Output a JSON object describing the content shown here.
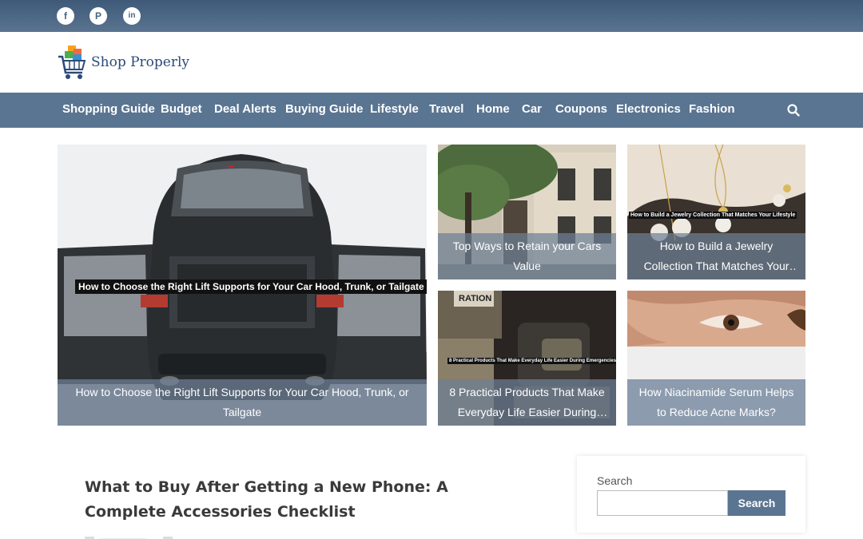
{
  "topbar": {
    "social": [
      {
        "name": "facebook-icon",
        "glyph": "f"
      },
      {
        "name": "pinterest-icon",
        "glyph": "P"
      },
      {
        "name": "linkedin-icon",
        "glyph": "in"
      }
    ]
  },
  "header": {
    "site_name": "Shop Properly"
  },
  "nav": {
    "items": [
      "Shopping Guide",
      "Budget",
      "Deal Alerts",
      "Buying Guide",
      "Lifestyle",
      "Travel",
      "Home",
      "Car",
      "Coupons",
      "Electronics",
      "Fashion"
    ],
    "search_icon": "search-icon"
  },
  "featured": {
    "main": {
      "image_label": "How to Choose the Right Lift Supports for Your Car Hood, Trunk, or Tailgate",
      "caption": "How to Choose the Right Lift Supports for Your Car Hood, Trunk, or Tailgate"
    },
    "tiles": [
      {
        "caption": "Top Ways to Retain your Cars Value"
      },
      {
        "image_label": "How to Build a Jewelry Collection That Matches Your Lifestyle",
        "caption": "How to Build a Jewelry Collection That Matches Your Lifestyle"
      },
      {
        "image_label": "8 Practical Products That Make Everyday Life Easier During Emergencies",
        "caption": "8 Practical Products That Make Everyday Life Easier During Emergencies",
        "sign_text": "RATION"
      },
      {
        "caption": "How Niacinamide Serum Helps to Reduce Acne Marks?"
      }
    ]
  },
  "post": {
    "title": "What to Buy After Getting a New Phone: A Complete Accessories Checklist"
  },
  "sidebar": {
    "search_label": "Search",
    "search_value": "",
    "search_button": "Search"
  },
  "colors": {
    "accent": "#5a7591",
    "topbar": "#4a6580",
    "caption_bg": "#6e8096"
  }
}
